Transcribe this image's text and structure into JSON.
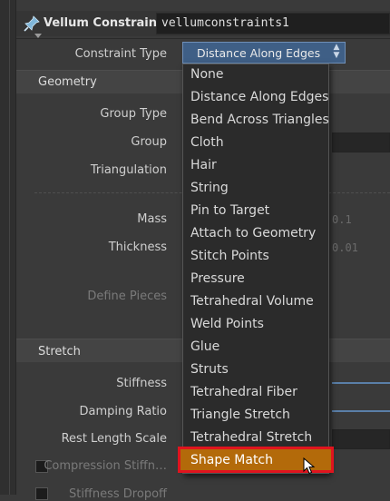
{
  "node": {
    "type_title": "Vellum Constraints",
    "name": "vellumconstraints1",
    "icon": "pin-icon"
  },
  "constraint_type": {
    "label": "Constraint Type",
    "selected": "Distance Along Edges"
  },
  "sections": {
    "geometry": "Geometry",
    "stretch": "Stretch"
  },
  "geometry_params": {
    "group_type": "Group Type",
    "group": "Group",
    "triangulation": "Triangulation",
    "mass": "Mass",
    "thickness": "Thickness",
    "define_pieces": "Define Pieces"
  },
  "stretch_params": {
    "stiffness": "Stiffness",
    "damping_ratio": "Damping Ratio",
    "rest_length_scale": "Rest Length Scale",
    "compression_stiffness": "Compression Stiffn…",
    "stiffness_dropoff": "Stiffness Dropoff"
  },
  "ghost_values": {
    "mass": "0.1",
    "thickness": "0.01"
  },
  "menu": {
    "items": [
      "None",
      "Distance Along Edges",
      "Bend Across Triangles",
      "Cloth",
      "Hair",
      "String",
      "Pin to Target",
      "Attach to Geometry",
      "Stitch Points",
      "Pressure",
      "Tetrahedral Volume",
      "Weld Points",
      "Glue",
      "Struts",
      "Tetrahedral Fiber",
      "Triangle Stretch",
      "Tetrahedral Stretch"
    ],
    "highlighted": "Shape Match"
  },
  "colors": {
    "highlight": "#b36a0a",
    "highlight_outline": "#e0141e",
    "dropdown_button": "#3f5f86"
  }
}
